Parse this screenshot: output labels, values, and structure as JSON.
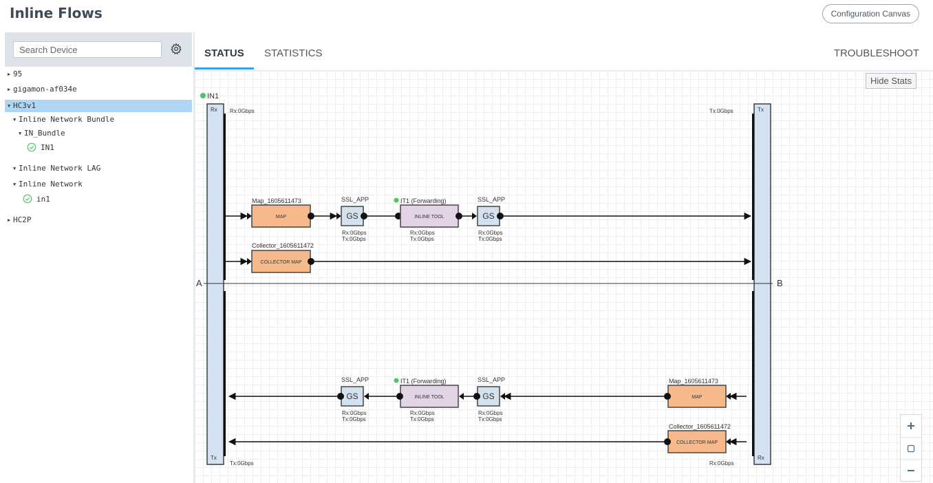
{
  "header": {
    "title": "Inline Flows",
    "config_button": "Configuration Canvas"
  },
  "sidebar": {
    "search_placeholder": "Search Device",
    "tree": [
      {
        "label": "95",
        "expanded": false
      },
      {
        "label": "gigamon-af034e",
        "expanded": false
      },
      {
        "label": "HC3v1",
        "expanded": true,
        "selected": true
      },
      {
        "label": "Inline Network Bundle",
        "expanded": true
      },
      {
        "label": "IN_Bundle",
        "expanded": true
      },
      {
        "label": "IN1",
        "status": "ok"
      },
      {
        "label": "Inline Network LAG",
        "expanded": true
      },
      {
        "label": "Inline Network",
        "expanded": true
      },
      {
        "label": "in1",
        "status": "ok"
      },
      {
        "label": "HC2P",
        "expanded": false
      }
    ]
  },
  "tabs": {
    "status": "STATUS",
    "statistics": "STATISTICS",
    "troubleshoot": "TROUBLESHOOT"
  },
  "canvas": {
    "hide_stats": "Hide Stats",
    "inline_network": "IN1",
    "side_a": "A",
    "side_b": "B",
    "port_rx": "Rx",
    "port_tx": "Tx",
    "rx_top": "Rx:0Gbps",
    "tx_top": "Tx:0Gbps",
    "tx_bottom": "Tx:0Gbps",
    "rx_bottom": "Rx:0Gbps",
    "map_name": "Map_1605611473",
    "map_label": "MAP",
    "collector_name": "Collector_1605611472",
    "collector_label": "COLLECTOR MAP",
    "gs_app": "SSL_APP",
    "gs_label": "GS",
    "tool_name": "IT1 (Forwarding)",
    "tool_label": "INLINE TOOL",
    "stat_rx": "Rx:0Gbps",
    "stat_tx": "Tx:0Gbps"
  },
  "colors": {
    "map_fill": "#f7b98a",
    "tool_fill": "#e3d3e6",
    "gs_fill": "#d4e1ee",
    "port_fill": "#d3e1f0",
    "status_green": "#4cc366",
    "selected_bg": "#aed6f5",
    "tab_accent": "#35a5e4"
  },
  "zoom": {
    "zoom_in": "+",
    "zoom_out": "−"
  }
}
